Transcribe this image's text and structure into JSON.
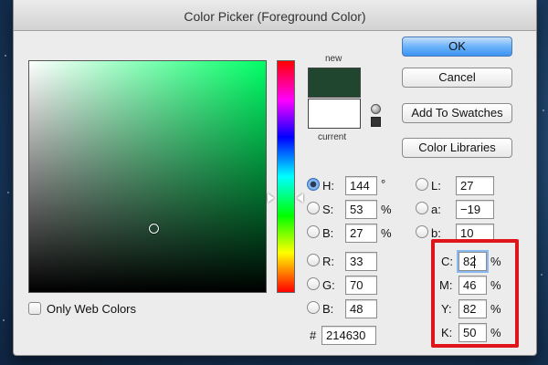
{
  "window": {
    "title": "Color Picker (Foreground Color)"
  },
  "preview": {
    "new_label": "new",
    "current_label": "current",
    "new_color": "#214630",
    "current_color": "#ffffff"
  },
  "buttons": {
    "ok": "OK",
    "cancel": "Cancel",
    "add_to_swatches": "Add To Swatches",
    "color_libraries": "Color Libraries"
  },
  "hsb": [
    {
      "label": "H:",
      "value": "144",
      "unit": "°",
      "selected": true
    },
    {
      "label": "S:",
      "value": "53",
      "unit": "%",
      "selected": false
    },
    {
      "label": "B:",
      "value": "27",
      "unit": "%",
      "selected": false
    }
  ],
  "rgb": [
    {
      "label": "R:",
      "value": "33"
    },
    {
      "label": "G:",
      "value": "70"
    },
    {
      "label": "B:",
      "value": "48"
    }
  ],
  "lab": [
    {
      "label": "L:",
      "value": "27"
    },
    {
      "label": "a:",
      "value": "−19"
    },
    {
      "label": "b:",
      "value": "10"
    }
  ],
  "cmyk": [
    {
      "label": "C:",
      "value": "82",
      "unit": "%"
    },
    {
      "label": "M:",
      "value": "46",
      "unit": "%"
    },
    {
      "label": "Y:",
      "value": "82",
      "unit": "%"
    },
    {
      "label": "K:",
      "value": "50",
      "unit": "%"
    }
  ],
  "hex": {
    "prefix": "#",
    "value": "214630"
  },
  "only_web_colors": {
    "label": "Only Web Colors",
    "checked": false
  },
  "colors": {
    "highlight": "#e0141b",
    "ok_button": "#3d94f1"
  }
}
